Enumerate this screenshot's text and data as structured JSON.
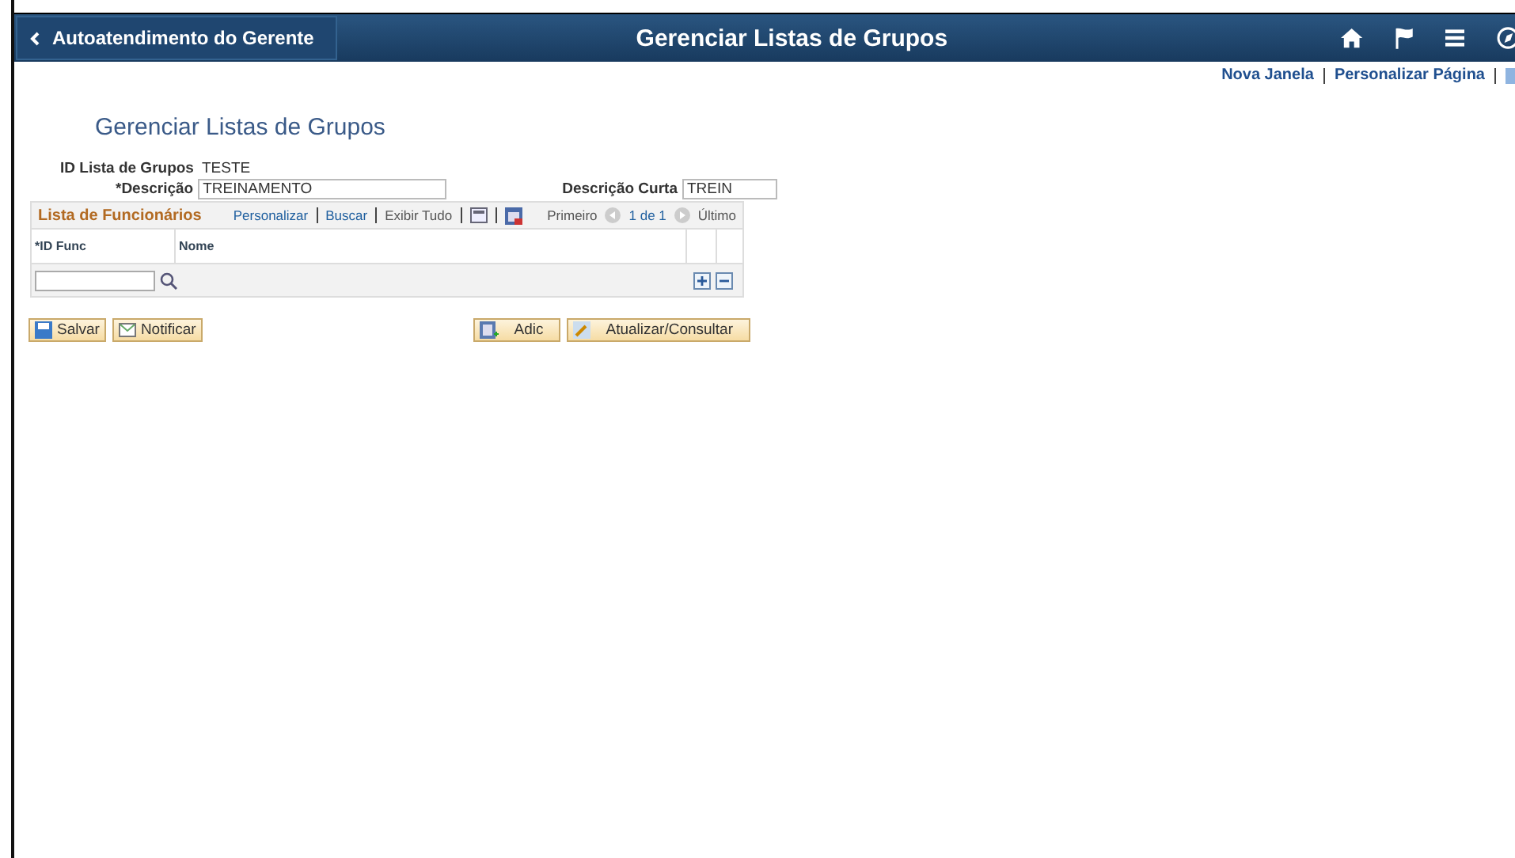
{
  "header": {
    "back_label": "Autoatendimento do Gerente",
    "title": "Gerenciar Listas de Grupos"
  },
  "links": [
    "Nova Janela",
    "Personalizar Página"
  ],
  "page_title": "Gerenciar Listas de Grupos",
  "fields": {
    "id_label": "ID Lista de Grupos",
    "id_value": "TESTE",
    "desc_label": "*Descrição",
    "desc_value": "TREINAMENTO",
    "short_label": "Descrição Curta",
    "short_value": "TREIN"
  },
  "grid": {
    "title": "Lista de Funcionários",
    "tools": [
      "Personalizar",
      "Buscar"
    ],
    "show_all": "Exibir Tudo",
    "first": "Primeiro",
    "range": "1 de 1",
    "last": "Último",
    "columns": [
      "*ID Func",
      "Nome"
    ]
  },
  "buttons_left": [
    "Salvar",
    "Notificar"
  ],
  "buttons_right": [
    "Adic",
    "Atualizar/Consultar"
  ]
}
